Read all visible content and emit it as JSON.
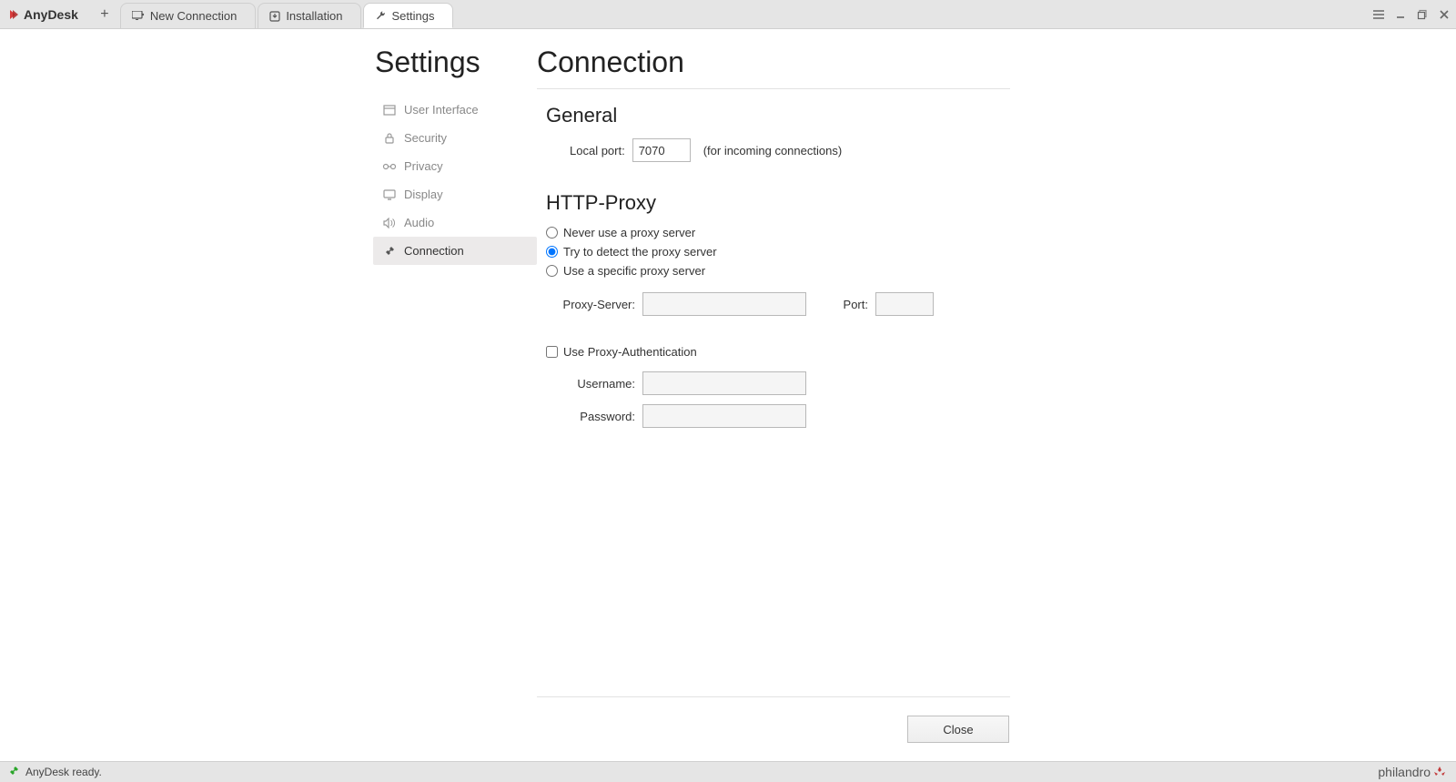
{
  "app": {
    "name": "AnyDesk"
  },
  "tabs": [
    {
      "label": "New Connection"
    },
    {
      "label": "Installation"
    },
    {
      "label": "Settings"
    }
  ],
  "sidebar": {
    "title": "Settings",
    "items": [
      {
        "label": "User Interface"
      },
      {
        "label": "Security"
      },
      {
        "label": "Privacy"
      },
      {
        "label": "Display"
      },
      {
        "label": "Audio"
      },
      {
        "label": "Connection"
      }
    ]
  },
  "page": {
    "title": "Connection",
    "general": {
      "heading": "General",
      "local_port_label": "Local port:",
      "local_port_value": "7070",
      "local_port_hint": "(for incoming connections)"
    },
    "proxy": {
      "heading": "HTTP-Proxy",
      "option_never": "Never use a proxy server",
      "option_detect": "Try to detect the proxy server",
      "option_specific": "Use a specific proxy server",
      "server_label": "Proxy-Server:",
      "server_value": "",
      "port_label": "Port:",
      "port_value": "",
      "auth_checkbox": "Use Proxy-Authentication",
      "username_label": "Username:",
      "username_value": "",
      "password_label": "Password:",
      "password_value": ""
    },
    "close_button": "Close"
  },
  "status": {
    "text": "AnyDesk ready.",
    "brand": "philandro"
  }
}
